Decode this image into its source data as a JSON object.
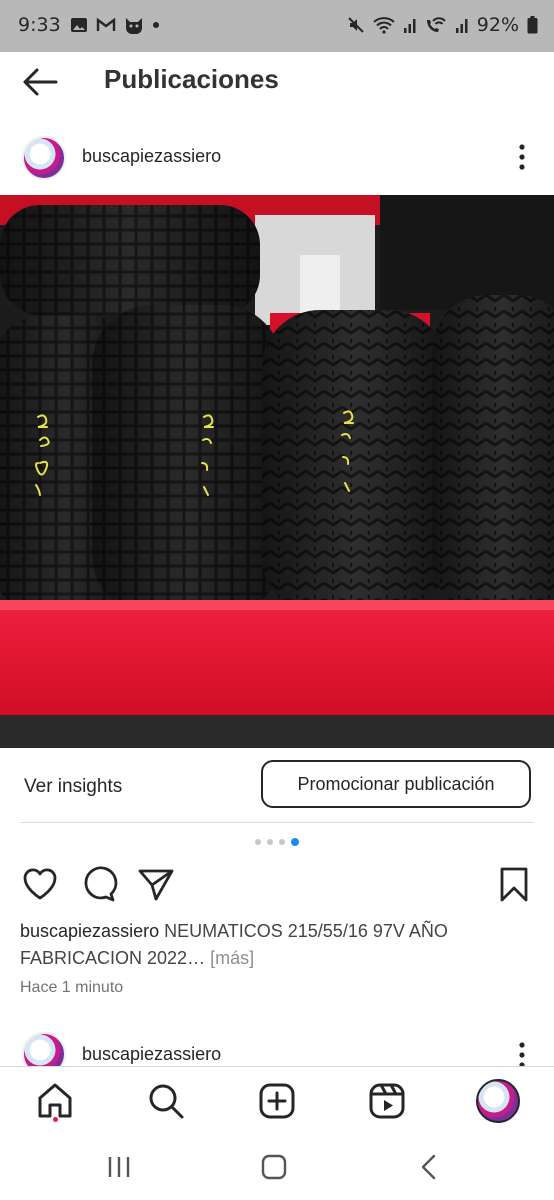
{
  "status_bar": {
    "time": "9:33",
    "battery": "92%",
    "left_icons": [
      "image-icon",
      "gmail-icon",
      "cat-icon",
      "dot-icon"
    ],
    "right_icons": [
      "mute-icon",
      "wifi-icon",
      "signal-icon",
      "wifi-call-icon",
      "signal-icon",
      "battery-icon"
    ]
  },
  "header": {
    "title": "Publicaciones"
  },
  "post": {
    "username": "buscapiezassiero",
    "image_description_icon": "tires-photo",
    "insights_label": "Ver insights",
    "promote_label": "Promocionar publicación",
    "carousel_total": 4,
    "carousel_active": 4,
    "caption_user": "buscapiezassiero",
    "caption_text": "NEUMATICOS 215/55/16 97V AÑO FABRICACION 2022…",
    "caption_more": "[más]",
    "time_ago": "Hace 1 minuto"
  },
  "next_post": {
    "username": "buscapiezassiero"
  },
  "colors": {
    "accent": "#1a8cf0",
    "notification": "#ed1c45",
    "shelf_red": "#e3102e"
  }
}
